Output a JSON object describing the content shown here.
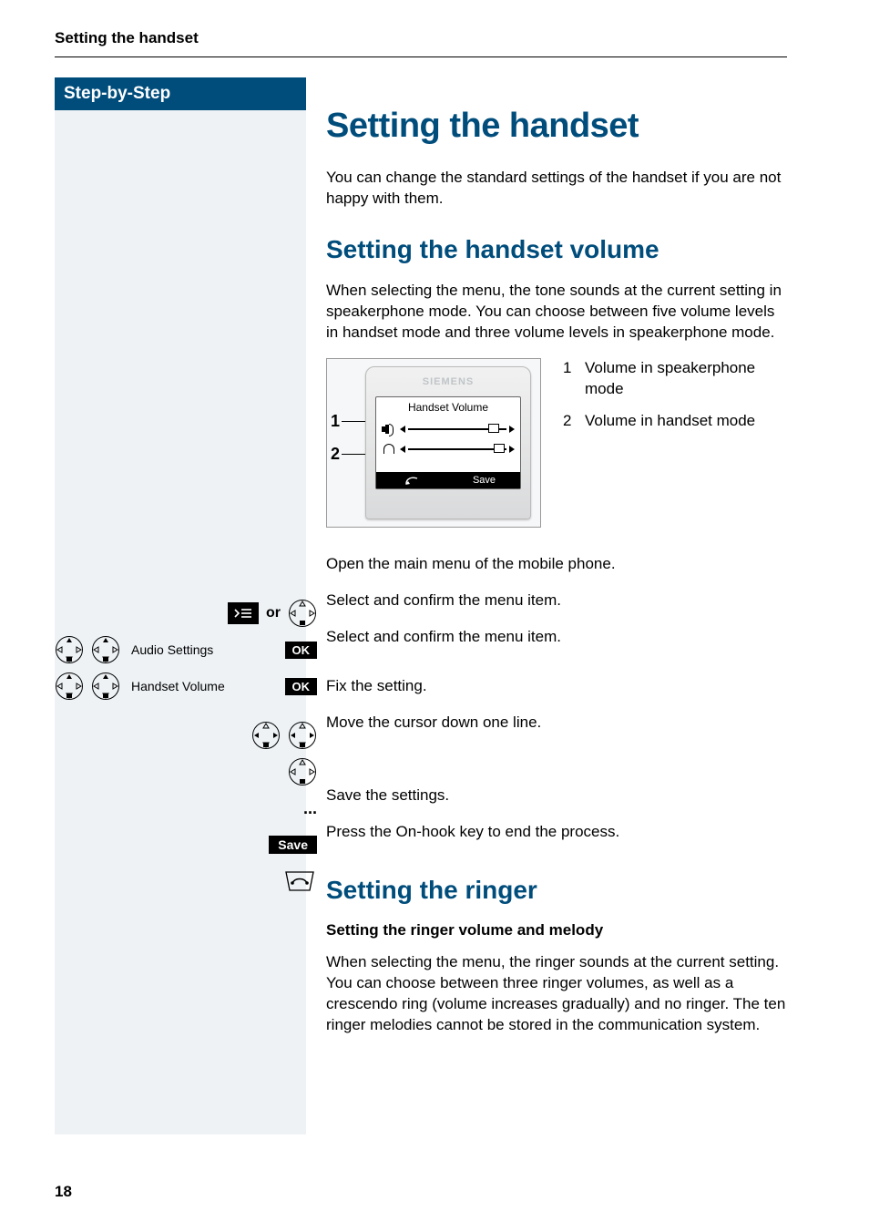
{
  "header": {
    "section_title": "Setting the handset"
  },
  "sidebar": {
    "title": "Step-by-Step"
  },
  "main": {
    "h1": "Setting the handset",
    "intro": "You can change the standard settings of the handset if you are not happy with them.",
    "section_volume": {
      "h2": "Setting the handset volume",
      "para": "When selecting the menu, the tone sounds at the current setting in speakerphone mode. You can choose between five volume levels in handset mode and three volume levels in speakerphone mode.",
      "phone": {
        "brand": "SIEMENS",
        "screen_title": "Handset Volume",
        "softkey_right": "Save"
      },
      "legend": [
        {
          "n": "1",
          "text": "Volume in speakerphone mode"
        },
        {
          "n": "2",
          "text": "Volume in handset mode"
        }
      ],
      "marker1": "1",
      "marker2": "2"
    },
    "steps": [
      {
        "left_label": "or",
        "right": "Open the main menu of the mobile phone."
      },
      {
        "left_menu": "Audio Settings",
        "ok": "OK",
        "right": "Select and confirm the menu item."
      },
      {
        "left_menu": "Handset Volume",
        "ok": "OK",
        "right": "Select and confirm the menu item."
      },
      {
        "right": "Fix the setting."
      },
      {
        "right": "Move the cursor down one line."
      },
      {
        "ellipsis": "...",
        "right": ""
      },
      {
        "save": "Save",
        "right": "Save the settings."
      },
      {
        "onhook": true,
        "right": "Press the On-hook key to end the process."
      }
    ],
    "section_ringer": {
      "h2": "Setting the ringer",
      "h3": "Setting the ringer volume and melody",
      "para": "When selecting the menu, the ringer sounds at the current setting. You can choose between three ringer volumes, as well as a crescendo ring (volume increases gradually) and no ringer. The ten ringer melodies cannot be stored in the communication system."
    }
  },
  "page_number": "18"
}
